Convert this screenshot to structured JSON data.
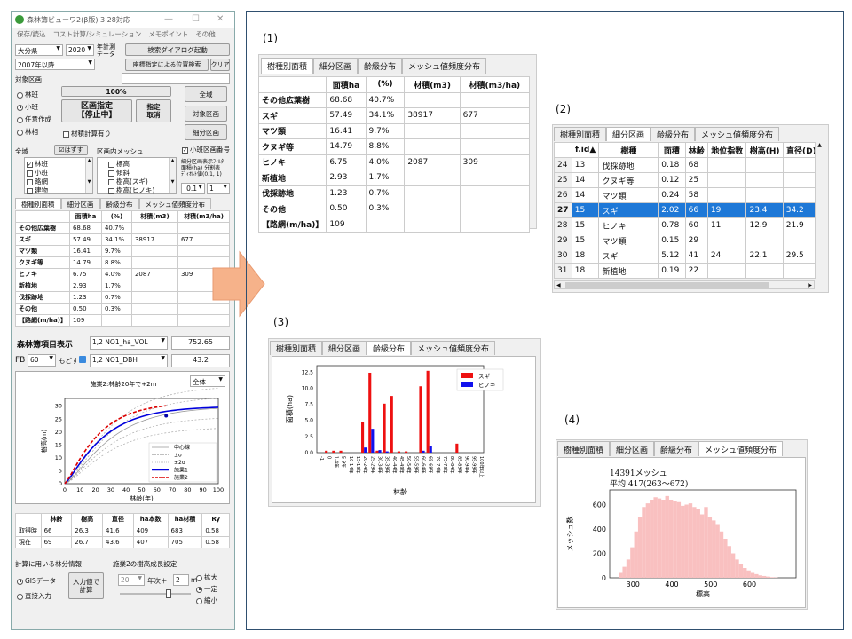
{
  "app": {
    "title": "森林簿ビューワ2(β版) 3.28対応",
    "menu": [
      "保存/読込",
      "コスト計算/シミュレーション",
      "メモポイント",
      "その他"
    ],
    "controls": {
      "pref": "大分県",
      "year": "2020",
      "year_label": "年計測\nデータ",
      "search_button": "検索ダイアログ起動",
      "period": "2007年以降",
      "coord_button": "座標指定による位置検索",
      "clear_button": "クリア",
      "target_area_label": "対象区画",
      "radio_options": [
        "林班",
        "小班",
        "任意作成",
        "林相"
      ],
      "selected_radio": 1,
      "progress": "100%",
      "progress_fraction": 1.0,
      "area_button_line1": "区画指定",
      "area_button_line2": "【停止中】",
      "designate_cancel": "指定\n取消",
      "wide_button": "全域",
      "target_area_button": "対象区画",
      "sub_area_button": "細分区画",
      "timber_calc": "材積計算有り"
    },
    "filter": {
      "all_label": "全域",
      "uncheck": "☑はずす",
      "mesh_label": "区画内メッシュ",
      "small_area_number": "小班区画番号",
      "left_list": [
        {
          "label": "林班",
          "checked": true
        },
        {
          "label": "小班",
          "checked": false
        },
        {
          "label": "路網",
          "checked": false
        },
        {
          "label": "建物",
          "checked": false
        }
      ],
      "mid_list": [
        "標高",
        "傾斜",
        "樹高(スギ)",
        "樹高(ヒノキ)"
      ],
      "note": "細分区画表示ﾌｨﾙﾀ\n面積(ha) 分割表\nﾃﾞｨｵﾙﾄ値(0.1, 1)",
      "val1": "0.1",
      "val2": "1"
    },
    "tabs": [
      "樹種別面積",
      "細分区画",
      "齢級分布",
      "メッシュ値頻度分布"
    ],
    "species_table": {
      "headers": [
        "",
        "面積ha",
        "(%)",
        "材積(m3)",
        "材積(m3/ha)"
      ],
      "rows": [
        [
          "その他広葉樹",
          "68.68",
          "40.7%",
          "",
          ""
        ],
        [
          "スギ",
          "57.49",
          "34.1%",
          "38917",
          "677"
        ],
        [
          "マツ類",
          "16.41",
          "9.7%",
          "",
          ""
        ],
        [
          "クヌギ等",
          "14.79",
          "8.8%",
          "",
          ""
        ],
        [
          "ヒノキ",
          "6.75",
          "4.0%",
          "2087",
          "309"
        ],
        [
          "新植地",
          "2.93",
          "1.7%",
          "",
          ""
        ],
        [
          "伐採跡地",
          "1.23",
          "0.7%",
          "",
          ""
        ],
        [
          "その他",
          "0.50",
          "0.3%",
          "",
          ""
        ],
        [
          "【路網(m/ha)】",
          "109",
          "",
          "",
          ""
        ]
      ]
    },
    "forest_register": {
      "label": "森林簿項目表示",
      "item1": "1,2 NO1_ha_VOL",
      "value1": "752.65",
      "fb_label": "FB",
      "fb_value": "60",
      "back_label": "もどす",
      "item2": "1,2 NO1_DBH",
      "value2": "43.2"
    },
    "growth_chart": {
      "dropdown": "全体",
      "title": "施業2:林齢20年で+2m",
      "xlabel": "林齢(年)",
      "ylabel": "樹高(m)",
      "xticks": [
        "0",
        "10",
        "20",
        "30",
        "40",
        "50",
        "60",
        "70",
        "80",
        "90",
        "100"
      ],
      "yticks": [
        "0",
        "5",
        "10",
        "15",
        "20",
        "25",
        "30"
      ],
      "legend": [
        "中心線",
        "±σ",
        "±2σ",
        "施業1",
        "施業2"
      ],
      "colors": {
        "treat1": "#0000dd",
        "treat2": "#dd0000",
        "center": "#999999"
      }
    },
    "summary_table": {
      "headers": [
        "",
        "林齢",
        "樹高",
        "直径",
        "ha本数",
        "ha材積",
        "Ry"
      ],
      "rows": [
        [
          "取得時",
          "66",
          "26.3",
          "41.6",
          "409",
          "683",
          "0.58"
        ],
        [
          "現在",
          "69",
          "26.7",
          "43.6",
          "407",
          "705",
          "0.58"
        ]
      ]
    },
    "bottom": {
      "info_label": "計算に用いる林分情報",
      "growth_label": "施業2の樹高成長設定",
      "gis": "GISデータ",
      "direct": "直接入力",
      "calc_button": "入力値で\n計算",
      "year_value": "20",
      "year_unit": "年次＋",
      "m_value": "2",
      "m_unit": "m",
      "options": [
        "拡大",
        "一定",
        "縮小"
      ],
      "selected_option": 1
    }
  },
  "panel1": {
    "label": "(1)",
    "tabs": [
      "樹種別面積",
      "細分区画",
      "齢級分布",
      "メッシュ値頻度分布"
    ],
    "headers": [
      "",
      "面積ha",
      "(%)",
      "材積(m3)",
      "材積(m3/ha)"
    ],
    "rows": [
      [
        "その他広葉樹",
        "68.68",
        "40.7%",
        "",
        ""
      ],
      [
        "スギ",
        "57.49",
        "34.1%",
        "38917",
        "677"
      ],
      [
        "マツ類",
        "16.41",
        "9.7%",
        "",
        ""
      ],
      [
        "クヌギ等",
        "14.79",
        "8.8%",
        "",
        ""
      ],
      [
        "ヒノキ",
        "6.75",
        "4.0%",
        "2087",
        "309"
      ],
      [
        "新植地",
        "2.93",
        "1.7%",
        "",
        ""
      ],
      [
        "伐採跡地",
        "1.23",
        "0.7%",
        "",
        ""
      ],
      [
        "その他",
        "0.50",
        "0.3%",
        "",
        ""
      ],
      [
        "【路網(m/ha)】",
        "109",
        "",
        "",
        ""
      ]
    ]
  },
  "panel2": {
    "label": "(2)",
    "tabs": [
      "樹種別面積",
      "細分区画",
      "齢級分布",
      "メッシュ値頻度分布"
    ],
    "headers": [
      "",
      "f.id▲",
      "樹種",
      "面積",
      "林齢",
      "地位指数",
      "樹高(H)",
      "直径(D)"
    ],
    "rows": [
      [
        "24",
        "13",
        "伐採跡地",
        "0.18",
        "68",
        "",
        "",
        ""
      ],
      [
        "25",
        "14",
        "クヌギ等",
        "0.12",
        "25",
        "",
        "",
        ""
      ],
      [
        "26",
        "14",
        "マツ類",
        "0.24",
        "58",
        "",
        "",
        ""
      ],
      [
        "27",
        "15",
        "スギ",
        "2.02",
        "66",
        "19",
        "23.4",
        "34.2"
      ],
      [
        "28",
        "15",
        "ヒノキ",
        "0.78",
        "60",
        "11",
        "12.9",
        "21.9"
      ],
      [
        "29",
        "15",
        "マツ類",
        "0.15",
        "29",
        "",
        "",
        ""
      ],
      [
        "30",
        "18",
        "スギ",
        "5.12",
        "41",
        "24",
        "22.1",
        "29.5"
      ],
      [
        "31",
        "18",
        "新植地",
        "0.19",
        "22",
        "",
        "",
        ""
      ]
    ],
    "selected_row": 3,
    "selection_color": "#1e78d7"
  },
  "panel3": {
    "label": "(3)",
    "tabs": [
      "樹種別面積",
      "細分区画",
      "齢級分布",
      "メッシュ値頻度分布"
    ]
  },
  "panel4": {
    "label": "(4)",
    "tabs": [
      "樹種別面積",
      "細分区画",
      "齢級分布",
      "メッシュ値頻度分布"
    ],
    "line1": "14391メッシュ",
    "line2": "平均 417(263〜672)"
  },
  "chart_data": [
    {
      "type": "bar",
      "xlabel": "林齢",
      "ylabel": "面積(ha)",
      "ylim": [
        0,
        13.5
      ],
      "yticks": [
        0.0,
        2.5,
        5.0,
        7.5,
        10.0,
        12.5
      ],
      "categories": [
        "-1",
        "0",
        "1-4年",
        "5-9年",
        "10-14年",
        "15-19年",
        "20-24年",
        "25-29年",
        "30-34年",
        "35-39年",
        "40-44年",
        "45-49年",
        "50-54年",
        "55-59年",
        "60-64年",
        "65-69年",
        "70-74年",
        "75-79年",
        "80-84年",
        "85-89年",
        "90-94年",
        "95-99年",
        "100年以上"
      ],
      "tick_labels": [
        "-1",
        "0",
        "1-4年",
        "5-9年",
        "10-14年",
        "15-19年",
        "20-24年",
        "25-29年",
        "30-34年",
        "35-39年",
        "40-44年",
        "45-49年",
        "50-54年",
        "55-59年",
        "60-64年",
        "65-69年",
        "70-74年",
        "75-79年",
        "80-84年",
        "85-89年",
        "90-94年",
        "95-99年",
        "100年以上"
      ],
      "series": [
        {
          "name": "スギ",
          "color": "#ee1111",
          "values": [
            0,
            0.3,
            0.3,
            0.3,
            0,
            0,
            4.8,
            12.4,
            0.3,
            7.6,
            8.8,
            0.2,
            0.2,
            0,
            10.3,
            12.7,
            0,
            0,
            0,
            1.4,
            0,
            0,
            0
          ]
        },
        {
          "name": "ヒノキ",
          "color": "#1111ee",
          "values": [
            0,
            0,
            0,
            0,
            0,
            0,
            0.8,
            3.7,
            0.4,
            0.2,
            0,
            0,
            0,
            0,
            0.3,
            1.1,
            0,
            0,
            0,
            0,
            0,
            0,
            0
          ]
        }
      ],
      "legend": "top-right"
    },
    {
      "type": "bar",
      "xlabel": "標高",
      "ylabel": "メッシュ数",
      "xlim": [
        240,
        720
      ],
      "xticks": [
        300,
        400,
        500,
        600
      ],
      "ylim": [
        0,
        720
      ],
      "yticks": [
        0,
        200,
        400,
        600
      ],
      "bin_start": 263,
      "bin_width": 10,
      "values": [
        40,
        90,
        150,
        250,
        380,
        500,
        580,
        610,
        640,
        660,
        650,
        640,
        670,
        640,
        630,
        620,
        590,
        600,
        610,
        580,
        560,
        520,
        580,
        500,
        470,
        440,
        380,
        320,
        260,
        200,
        150,
        110,
        80,
        60,
        40,
        30,
        20,
        15,
        10,
        5,
        3
      ],
      "color": "#f9c0c0"
    }
  ]
}
